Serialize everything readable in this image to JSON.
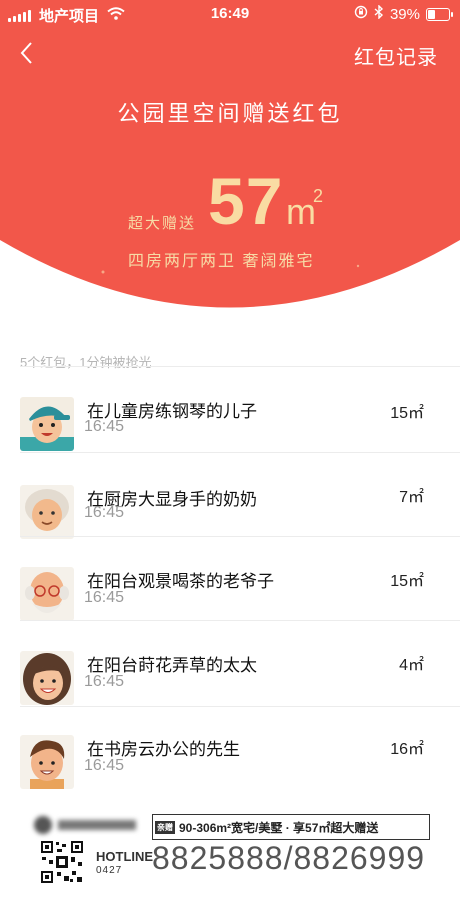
{
  "status_bar": {
    "carrier": "地产项目",
    "time": "16:49",
    "battery_percent": "39%",
    "battery_level": 0.39
  },
  "navbar": {
    "records_label": "红包记录"
  },
  "campaign": {
    "title": "公园里空间赠送红包",
    "prize_prefix": "超大赠送",
    "prize_number": "57",
    "prize_unit": "m",
    "prize_unit_sup": "2",
    "prize_desc": "四房两厅两卫   奢阔雅宅"
  },
  "summary": "5个红包，1分钟被抢光",
  "recipients": [
    {
      "name": "在儿童房练钢琴的儿子",
      "time": "16:45",
      "amount": "15㎡"
    },
    {
      "name": "在厨房大显身手的奶奶",
      "time": "16:45",
      "amount": "7㎡"
    },
    {
      "name": "在阳台观景喝茶的老爷子",
      "time": "16:45",
      "amount": "15㎡"
    },
    {
      "name": "在阳台莳花弄草的太太",
      "time": "16:45",
      "amount": "4㎡"
    },
    {
      "name": "在书房云办公的先生",
      "time": "16:45",
      "amount": "16㎡"
    }
  ],
  "footer": {
    "promo_tag": "亲赠",
    "promo_text": "90-306m²宽宅/美墅 · 享57㎡超大赠送",
    "hotline_label": "HOTLINE",
    "hotline_code": "0427",
    "hotline_number": "8825888/8826999"
  },
  "colors": {
    "header_red": "#f2574a",
    "gold_text": "#f9dca3"
  }
}
